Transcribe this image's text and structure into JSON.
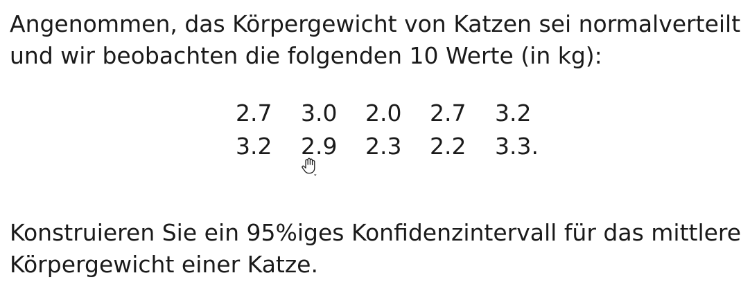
{
  "intro": {
    "line1": "Angenommen, das Körpergewicht von Katzen sei normalverteilt",
    "line2": "und wir beobachten die folgenden 10 Werte (in kg):"
  },
  "data_rows": [
    [
      "2.7",
      "3.0",
      "2.0",
      "2.7",
      "3.2"
    ],
    [
      "3.2",
      "2.9",
      "2.3",
      "2.2",
      "3.3."
    ]
  ],
  "task": {
    "line1": "Konstruieren Sie ein 95%iges Konfidenzintervall für das mittlere",
    "line2": "Körpergewicht einer Katze."
  },
  "cursor": {
    "icon": "hand-pointer-icon"
  }
}
